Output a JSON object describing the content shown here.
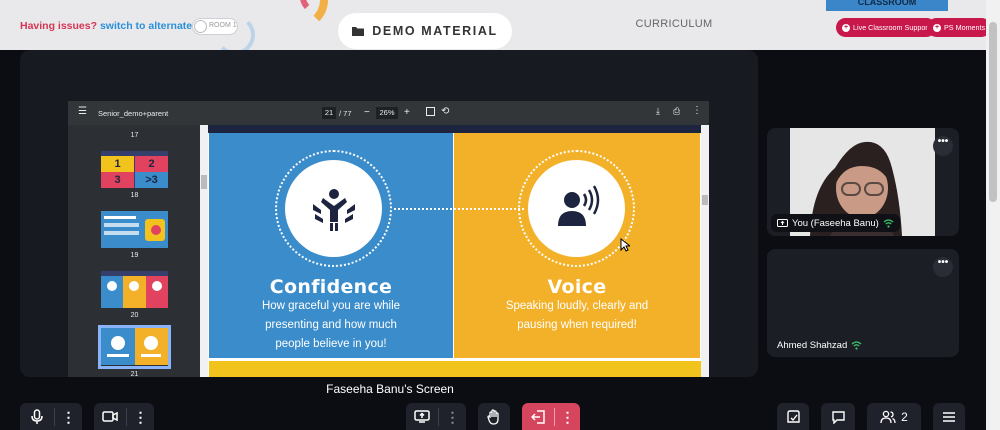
{
  "topbar": {
    "issues_text": "Having issues?",
    "switch_link": "switch to alternate room",
    "toggle_label": "ROOM 1",
    "tab_demo_label": "DEMO MATERIAL",
    "tab_curriculum_label": "CURRICULUM",
    "classroom_tag": "CLASSROOM",
    "support_label": "Live Classroom Support",
    "ps_label": "PS Moments"
  },
  "pdf": {
    "title": "Senior_demo+parent",
    "page_current": "21",
    "page_total": "/ 77",
    "zoom": "26%",
    "thumbs": [
      {
        "num": "17"
      },
      {
        "num": "18"
      },
      {
        "num": "19"
      },
      {
        "num": "20"
      },
      {
        "num": "21"
      }
    ],
    "thumb18_labels": [
      "1",
      "2",
      "3",
      ">3"
    ]
  },
  "slide": {
    "left_title": "Confidence",
    "left_sub_1": "How graceful you are while",
    "left_sub_2": "presenting and how much",
    "left_sub_3": "people believe in you!",
    "right_title": "Voice",
    "right_sub_1": "Speaking loudly, clearly and",
    "right_sub_2": "pausing when required!",
    "colors": {
      "blue": "#3a8ccb",
      "yellow": "#f3b12a",
      "navy": "#1d2440"
    }
  },
  "screen_label": "Faseeha Banu's Screen",
  "participants": [
    {
      "name": "You (Faseeha Banu)"
    },
    {
      "name": "Ahmed Shahzad"
    }
  ],
  "controls": {
    "participants_count": "2"
  },
  "icons": [
    "folder-icon",
    "mic-icon",
    "camera-icon",
    "screen-share-icon",
    "raise-hand-icon",
    "leave-icon",
    "whiteboard-icon",
    "chat-icon",
    "people-icon",
    "menu-icon",
    "wifi-icon",
    "more-icon"
  ]
}
